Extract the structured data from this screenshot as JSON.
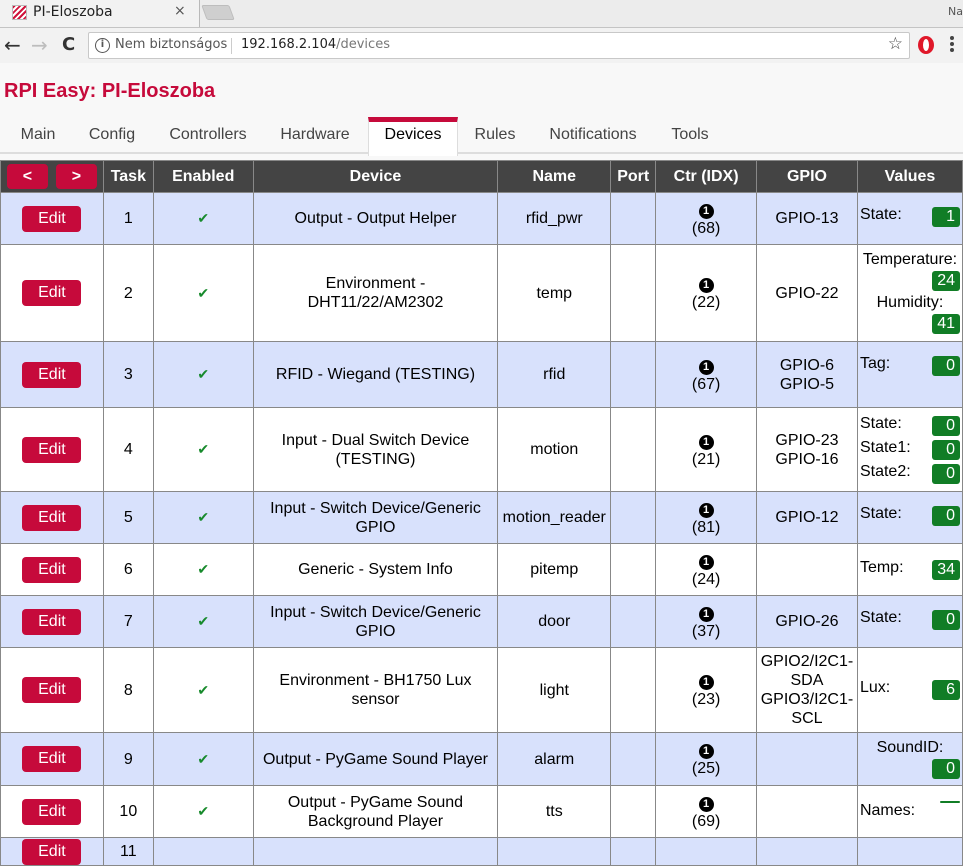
{
  "browser": {
    "tab_title": "PI-Eloszoba",
    "tab_close": "×",
    "profile_name": "Na",
    "back_icon": "←",
    "forward_icon": "→",
    "reload_icon": "C",
    "security_label": "Nem biztonságos",
    "url_host": "192.168.2.104",
    "url_path": "/devices",
    "star_icon": "☆"
  },
  "site": {
    "title": "RPI Easy: PI-Eloszoba",
    "accent_color": "#c60a3b"
  },
  "menu": [
    {
      "label": "Main",
      "active": false
    },
    {
      "label": "Config",
      "active": false
    },
    {
      "label": "Controllers",
      "active": false
    },
    {
      "label": "Hardware",
      "active": false
    },
    {
      "label": "Devices",
      "active": true
    },
    {
      "label": "Rules",
      "active": false
    },
    {
      "label": "Notifications",
      "active": false
    },
    {
      "label": "Tools",
      "active": false
    }
  ],
  "table": {
    "prev_label": "<",
    "next_label": ">",
    "headers": {
      "task": "Task",
      "enabled": "Enabled",
      "device": "Device",
      "name": "Name",
      "port": "Port",
      "ctr": "Ctr (IDX)",
      "gpio": "GPIO",
      "values": "Values"
    },
    "edit_label": "Edit",
    "check_glyph": "✔",
    "ctr_glyph": "1",
    "rows": [
      {
        "task": "1",
        "enabled": true,
        "device": "Output - Output Helper",
        "name": "rfid_pwr",
        "port": "",
        "ctr_idx": "(68)",
        "gpio": [
          "GPIO-13"
        ],
        "values": [
          {
            "label": "State:",
            "value": "1"
          }
        ]
      },
      {
        "task": "2",
        "enabled": true,
        "device": "Environment - DHT11/22/AM2302",
        "name": "temp",
        "port": "",
        "ctr_idx": "(22)",
        "gpio": [
          "GPIO-22"
        ],
        "values": [
          {
            "label": "Temperature:",
            "value": "24",
            "wrap": true
          },
          {
            "label": "Humidity:",
            "value": "41",
            "wrap": true
          }
        ]
      },
      {
        "task": "3",
        "enabled": true,
        "device": "RFID - Wiegand (TESTING)",
        "name": "rfid",
        "port": "",
        "ctr_idx": "(67)",
        "gpio": [
          "GPIO-6",
          "GPIO-5"
        ],
        "values": [
          {
            "label": "Tag:",
            "value": "0"
          }
        ]
      },
      {
        "task": "4",
        "enabled": true,
        "device": "Input - Dual Switch Device (TESTING)",
        "name": "motion",
        "port": "",
        "ctr_idx": "(21)",
        "gpio": [
          "GPIO-23",
          "GPIO-16"
        ],
        "values": [
          {
            "label": "State:",
            "value": "0"
          },
          {
            "label": "State1:",
            "value": "0"
          },
          {
            "label": "State2:",
            "value": "0"
          }
        ]
      },
      {
        "task": "5",
        "enabled": true,
        "device": "Input - Switch Device/Generic GPIO",
        "name": "motion_reader",
        "port": "",
        "ctr_idx": "(81)",
        "gpio": [
          "GPIO-12"
        ],
        "values": [
          {
            "label": "State:",
            "value": "0"
          }
        ]
      },
      {
        "task": "6",
        "enabled": true,
        "device": "Generic - System Info",
        "name": "pitemp",
        "port": "",
        "ctr_idx": "(24)",
        "gpio": [],
        "values": [
          {
            "label": "Temp:",
            "value": "34"
          }
        ]
      },
      {
        "task": "7",
        "enabled": true,
        "device": "Input - Switch Device/Generic GPIO",
        "name": "door",
        "port": "",
        "ctr_idx": "(37)",
        "gpio": [
          "GPIO-26"
        ],
        "values": [
          {
            "label": "State:",
            "value": "0"
          }
        ]
      },
      {
        "task": "8",
        "enabled": true,
        "device": "Environment - BH1750 Lux sensor",
        "name": "light",
        "port": "",
        "ctr_idx": "(23)",
        "gpio": [
          "GPIO2/I2C1-SDA",
          "GPIO3/I2C1-SCL"
        ],
        "values": [
          {
            "label": "Lux:",
            "value": "6"
          }
        ]
      },
      {
        "task": "9",
        "enabled": true,
        "device": "Output - PyGame Sound Player",
        "name": "alarm",
        "port": "",
        "ctr_idx": "(25)",
        "gpio": [],
        "values": [
          {
            "label": "SoundID:",
            "value": "0",
            "wrap": true
          }
        ]
      },
      {
        "task": "10",
        "enabled": true,
        "device": "Output - PyGame Sound Background Player",
        "name": "tts",
        "port": "",
        "ctr_idx": "(69)",
        "gpio": [],
        "values": [
          {
            "label": "Names:",
            "value": ""
          }
        ]
      },
      {
        "task": "11",
        "enabled": false,
        "device": "",
        "name": "",
        "port": "",
        "ctr_idx": "",
        "gpio": [],
        "values": []
      }
    ]
  }
}
